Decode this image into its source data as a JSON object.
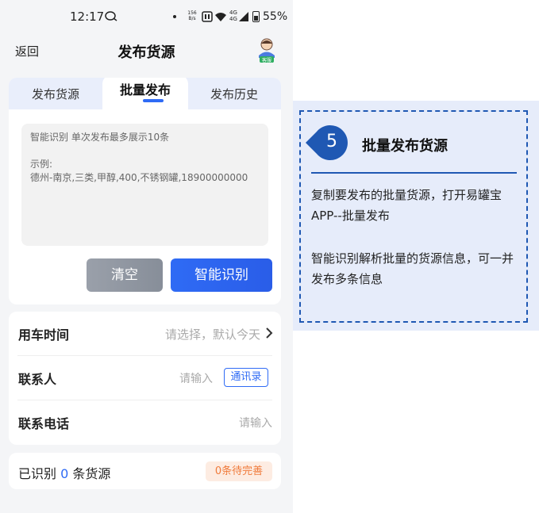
{
  "status_bar": {
    "time": "12:17",
    "net_speed_value": "156",
    "net_speed_unit": "B/s",
    "network_type": "4G",
    "battery": "55%"
  },
  "nav": {
    "back_label": "返回",
    "title": "发布货源",
    "service_label": "客服"
  },
  "tabs": [
    {
      "label": "发布货源",
      "active": false
    },
    {
      "label": "批量发布",
      "active": true
    },
    {
      "label": "发布历史",
      "active": false
    }
  ],
  "batch_input": {
    "hint": "智能识别 单次发布最多展示10条",
    "example_label": "示例:",
    "example_value": "德州-南京,三类,甲醇,400,不锈钢罐,18900000000"
  },
  "buttons": {
    "clear": "清空",
    "recognize": "智能识别"
  },
  "form": {
    "rows": [
      {
        "label": "用车时间",
        "placeholder": "请选择，默认今天"
      },
      {
        "label": "联系人",
        "placeholder": "请输入",
        "action": "通讯录"
      },
      {
        "label": "联系电话",
        "placeholder": "请输入"
      }
    ]
  },
  "recognized": {
    "prefix": "已识别",
    "count": "0",
    "suffix": "条货源",
    "badge": "0条待完善"
  },
  "callout": {
    "step": "5",
    "title": "批量发布货源",
    "para1": "复制要发布的批量货源，打开易罐宝APP--批量发布",
    "para2": "智能识别解析批量的货源信息，可一并发布多条信息"
  },
  "colors": {
    "accent": "#2f6bf5",
    "callout_border": "#1f58b3",
    "callout_bg": "#e6ecfa",
    "badge_text": "#f07a3a",
    "badge_bg": "#fdece2"
  }
}
